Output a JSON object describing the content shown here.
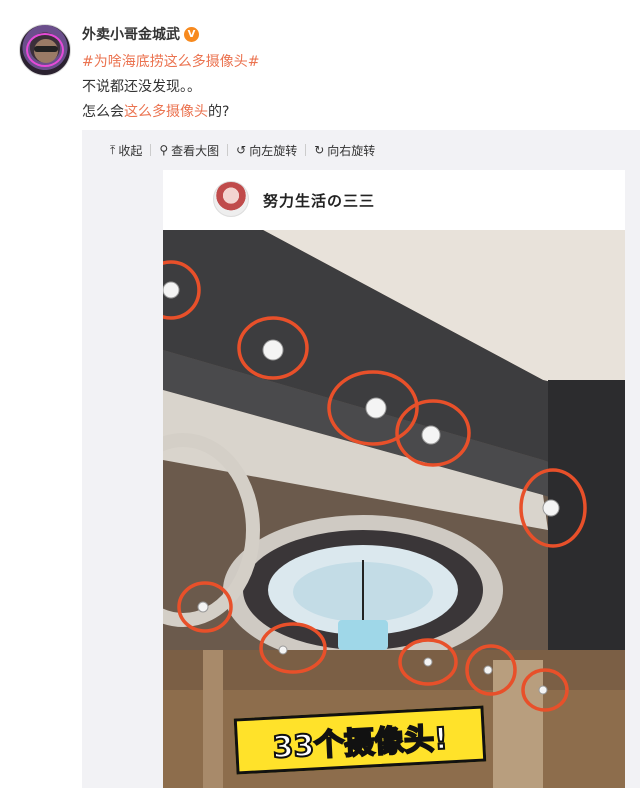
{
  "post": {
    "username": "外卖小哥金城武",
    "verified_badge": "V",
    "hashtag": "#为啥海底捞这么多摄像头#",
    "line2": "不说都还没发现。。",
    "line3_before": "怎么会",
    "line3_highlight": "这么多摄像头",
    "line3_after": "的?"
  },
  "toolbar": {
    "collapse": "收起",
    "view_large": "查看大图",
    "rotate_left": "向左旋转",
    "rotate_right": "向右旋转"
  },
  "image": {
    "author": "努力生活の三三",
    "caption": "33个摄像头!"
  },
  "colors": {
    "accent": "#eb7350",
    "badge": "#f78a1f",
    "circle": "#e8502a",
    "caption_bg": "#ffe22a"
  },
  "icons": {
    "collapse": "arrow-up-icon",
    "view_large": "magnifier-icon",
    "rotate_left": "rotate-left-icon",
    "rotate_right": "rotate-right-icon"
  }
}
